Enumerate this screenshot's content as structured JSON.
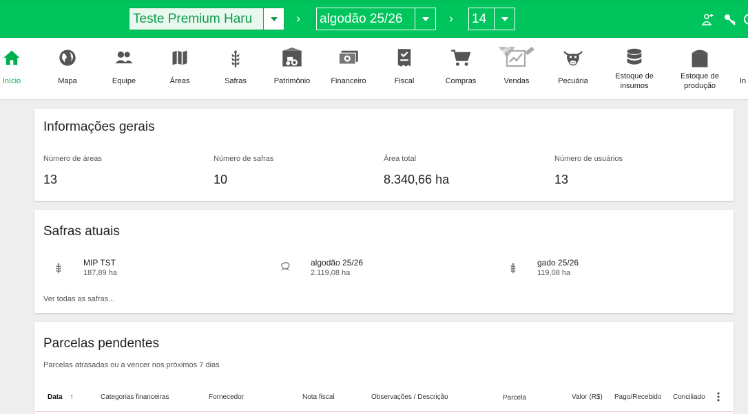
{
  "topbar": {
    "farm": "Teste Premium Haru",
    "safra": "algodão 25/26",
    "number": "14",
    "chevron": "›",
    "icons": [
      "user-plus-icon",
      "key-icon",
      "account-icon"
    ]
  },
  "nav": {
    "items": [
      {
        "label": "Início",
        "icon": "home-icon"
      },
      {
        "label": "Mapa",
        "icon": "globe-icon"
      },
      {
        "label": "Equipe",
        "icon": "people-icon"
      },
      {
        "label": "Áreas",
        "icon": "map-icon"
      },
      {
        "label": "Safras",
        "icon": "wheat-icon"
      },
      {
        "label": "Patrimônio",
        "icon": "tractor-icon"
      },
      {
        "label": "Financeiro",
        "icon": "money-icon"
      },
      {
        "label": "Fiscal",
        "icon": "invoice-icon"
      },
      {
        "label": "Compras",
        "icon": "cart-icon"
      },
      {
        "label": "Vendas",
        "icon": "sales-icon",
        "badge": "PRO"
      },
      {
        "label": "Pecuária",
        "icon": "cow-icon"
      },
      {
        "label": "Estoque de insumos",
        "icon": "database-icon"
      },
      {
        "label": "Estoque de produção",
        "icon": "silo-icon"
      },
      {
        "label": "In",
        "icon": "more-icon"
      }
    ]
  },
  "general": {
    "title": "Informações gerais",
    "stats": [
      {
        "label": "Número de áreas",
        "value": "13"
      },
      {
        "label": "Número de safras",
        "value": "10"
      },
      {
        "label": "Área total",
        "value": "8.340,66 ha"
      },
      {
        "label": "Número de usuários",
        "value": "13"
      }
    ]
  },
  "safras": {
    "title": "Safras atuais",
    "items": [
      {
        "name": "MIP TST",
        "area": "187,89 ha",
        "icon": "wheat-icon"
      },
      {
        "name": "algodão 25/26",
        "area": "2.119,08 ha",
        "icon": "cotton-icon"
      },
      {
        "name": "gado 25/26",
        "area": "119,08 ha",
        "icon": "wheat-icon"
      }
    ],
    "link": "Ver todas as safras..."
  },
  "parcelas": {
    "title": "Parcelas pendentes",
    "subtitle": "Parcelas atrasadas ou a vencer nos próximos 7 dias",
    "columns": [
      "Data",
      "Categorias financeiras",
      "Fornecedor",
      "Nota fiscal",
      "Observações / Descrição",
      "Parcela",
      "Valor (R$)",
      "Pago/Recebido",
      "Conciliado"
    ],
    "sort_arrow": "↑"
  },
  "colors": {
    "brand_green": "#00c45c",
    "active_green": "#00b050"
  }
}
